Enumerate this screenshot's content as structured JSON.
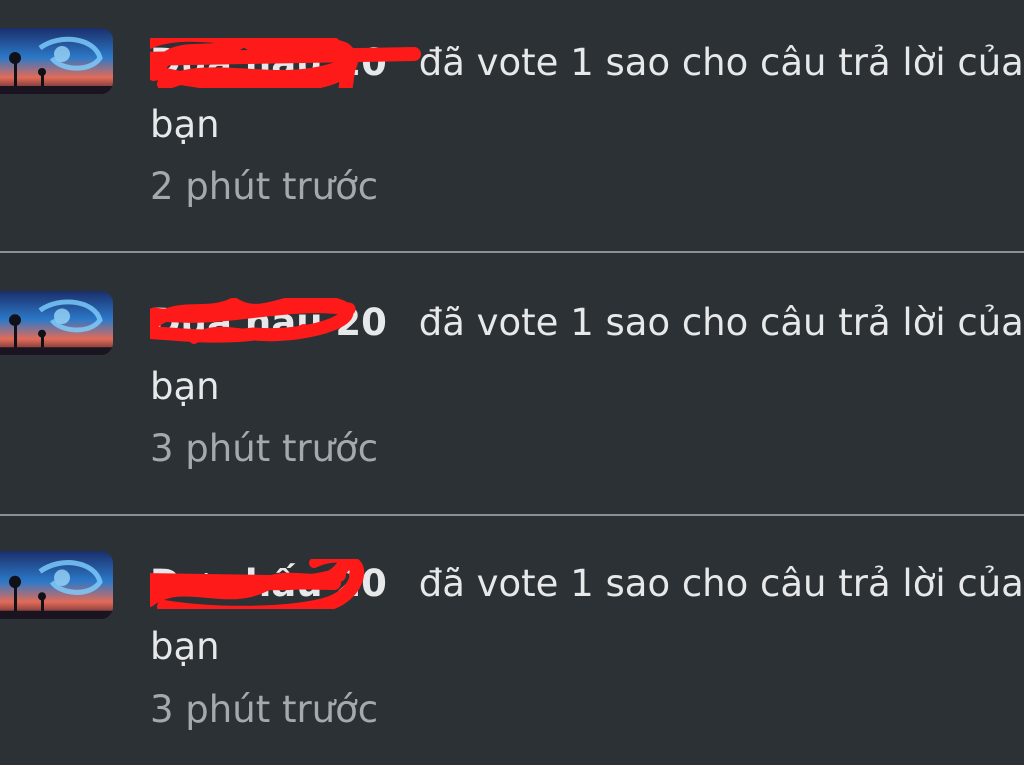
{
  "notifications": [
    {
      "username": "Dưa hấu 20",
      "action": "đã vote 1 sao cho câu trả lời của",
      "object": "bạn",
      "time": "2 phút trước",
      "username_redacted": true
    },
    {
      "username": "Dưa hấu 20",
      "action": "đã vote 1 sao cho câu trả lời của",
      "object": "bạn",
      "time": "3 phút trước",
      "username_redacted": true
    },
    {
      "username": "Dưa hấu 20",
      "action": "đã vote 1 sao cho câu trả lời của",
      "object": "bạn",
      "time": "3 phút trước",
      "username_redacted": true
    }
  ],
  "colors": {
    "background": "#2b3135",
    "text_primary": "#e6e8e9",
    "text_secondary": "#a4a9ad",
    "divider": "#8a9196",
    "redaction": "#ff1a1a"
  },
  "icons": {
    "avatar": "avatar-sky-scene"
  }
}
